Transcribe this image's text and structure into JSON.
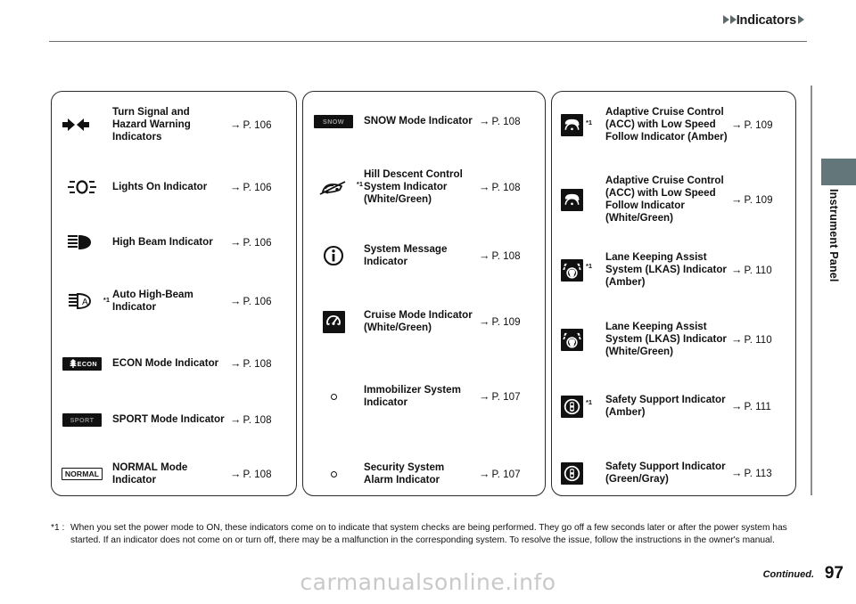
{
  "header": {
    "title": "Indicators"
  },
  "sidebar": {
    "label": "Instrument Panel"
  },
  "arrow_glyph": "→",
  "footnote": {
    "label": "*1 :",
    "text": "When you set the power mode to ON, these indicators come on to indicate that system checks are being performed. They go off a few seconds later or after the power system has started. If an indicator does not come on or turn off, there may be a malfunction in the corresponding system. To resolve the issue, follow the instructions in the owner's manual."
  },
  "footer": {
    "watermark": "carmanualsonline.info",
    "continued": "Continued.",
    "page_number": "97"
  },
  "columns": [
    {
      "id": "column-1",
      "rows": [
        {
          "icon": "turn-signal-hazard-icon",
          "asterisk": "",
          "label": "Turn Signal and Hazard Warning Indicators",
          "page": "P. 106"
        },
        {
          "icon": "lights-on-icon",
          "asterisk": "",
          "label": "Lights On Indicator",
          "page": "P. 106"
        },
        {
          "icon": "high-beam-icon",
          "asterisk": "",
          "label": "High Beam Indicator",
          "page": "P. 106"
        },
        {
          "icon": "auto-high-beam-icon",
          "asterisk": "*1",
          "label": "Auto High-Beam Indicator",
          "page": "P. 106"
        },
        {
          "icon": "econ-badge-icon",
          "asterisk": "",
          "label_bold": "ECON",
          "label": " Mode Indicator",
          "page": "P. 108"
        },
        {
          "icon": "sport-badge-icon",
          "asterisk": "",
          "label_bold": "SPORT",
          "label": " Mode Indicator",
          "page": "P. 108"
        },
        {
          "icon": "normal-badge-icon",
          "asterisk": "",
          "label_bold": "NORMAL",
          "label": " Mode Indicator",
          "page": "P. 108"
        }
      ]
    },
    {
      "id": "column-2",
      "rows": [
        {
          "icon": "snow-badge-icon",
          "asterisk": "",
          "label_bold": "SNOW",
          "label": " Mode Indicator",
          "page": "P. 108"
        },
        {
          "icon": "hill-descent-control-icon",
          "asterisk": "*1",
          "label": "Hill Descent Control System Indicator (White/Green)",
          "page": "P. 108"
        },
        {
          "icon": "system-message-info-icon",
          "asterisk": "",
          "label": "System Message Indicator",
          "page": "P. 108"
        },
        {
          "icon": "cruise-mode-icon",
          "asterisk": "",
          "label": "Cruise Mode Indicator (White/Green)",
          "page": "P. 109"
        },
        {
          "icon": "immobilizer-system-icon",
          "asterisk": "",
          "label": "Immobilizer System Indicator",
          "page": "P. 107"
        },
        {
          "icon": "security-system-alarm-icon",
          "asterisk": "",
          "label": "Security System Alarm Indicator",
          "page": "P. 107"
        }
      ]
    },
    {
      "id": "column-3",
      "rows": [
        {
          "icon": "acc-low-speed-follow-amber-icon",
          "asterisk": "*1",
          "label": "Adaptive Cruise Control (ACC) with Low Speed Follow Indicator (Amber)",
          "page": "P. 109"
        },
        {
          "icon": "acc-low-speed-follow-white-green-icon",
          "asterisk": "",
          "label": "Adaptive Cruise Control (ACC) with Low Speed Follow Indicator (White/Green)",
          "page": "P. 109"
        },
        {
          "icon": "lkas-amber-icon",
          "asterisk": "*1",
          "label": "Lane Keeping Assist System (LKAS) Indicator (Amber)",
          "page": "P. 110"
        },
        {
          "icon": "lkas-white-green-icon",
          "asterisk": "",
          "label": "Lane Keeping Assist System (LKAS) Indicator (White/Green)",
          "page": "P. 110"
        },
        {
          "icon": "safety-support-amber-icon",
          "asterisk": "*1",
          "label": "Safety Support Indicator (Amber)",
          "page": "P. 111"
        },
        {
          "icon": "safety-support-green-gray-icon",
          "asterisk": "",
          "label": "Safety Support Indicator (Green/Gray)",
          "page": "P. 113"
        }
      ]
    }
  ]
}
